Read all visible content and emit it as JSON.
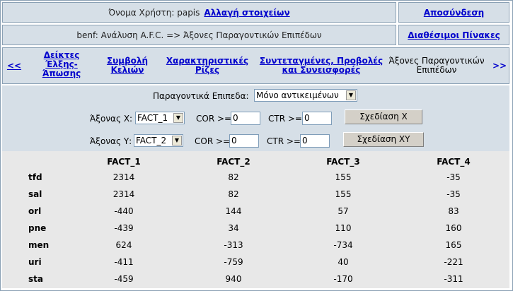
{
  "header": {
    "user_label": "Όνομα Χρήστη: papis",
    "change_details_link": "Αλλαγή στοιχείων",
    "logout_link": "Αποσύνδεση",
    "analysis_title": "benf: Ανάλυση A.F.C. => Άξονες Παραγοντικών Επιπέδων",
    "available_tables_link": "Διαθέσιμοι Πίνακες"
  },
  "nav": {
    "prev": "<<",
    "next": ">>",
    "items": [
      {
        "label": "Δείκτες Έλξης-Άπωσης"
      },
      {
        "label": "Συμβολή Κελιών"
      },
      {
        "label": "Χαρακτηριστικές Ρίζες"
      },
      {
        "label": "Συντεταγμένες, Προβολές και Συνεισφορές"
      },
      {
        "label": "Άξονες Παραγοντικών Επιπέδων"
      }
    ]
  },
  "form": {
    "planes_label": "Παραγοντικά Επιπεδα:",
    "planes_value": "Μόνο αντικειμένων",
    "axis_x_label": "Άξονας Χ:",
    "axis_x_value": "FACT_1",
    "axis_y_label": "Άξονας Υ:",
    "axis_y_value": "FACT_2",
    "cor_label": "COR >=",
    "ctr_label": "CTR >=",
    "cor_x": "0",
    "ctr_x": "0",
    "cor_y": "0",
    "ctr_y": "0",
    "plot_x_button": "Σχεδίαση Χ",
    "plot_xy_button": "Σχεδίαση ΧΥ"
  },
  "table": {
    "columns": [
      "FACT_1",
      "FACT_2",
      "FACT_3",
      "FACT_4"
    ],
    "rows": [
      {
        "label": "tfd",
        "values": [
          "2314",
          "82",
          "155",
          "-35"
        ]
      },
      {
        "label": "sal",
        "values": [
          "2314",
          "82",
          "155",
          "-35"
        ]
      },
      {
        "label": "orl",
        "values": [
          "-440",
          "144",
          "57",
          "83"
        ]
      },
      {
        "label": "pne",
        "values": [
          "-439",
          "34",
          "110",
          "160"
        ]
      },
      {
        "label": "men",
        "values": [
          "624",
          "-313",
          "-734",
          "165"
        ]
      },
      {
        "label": "uri",
        "values": [
          "-411",
          "-759",
          "40",
          "-221"
        ]
      },
      {
        "label": "sta",
        "values": [
          "-459",
          "940",
          "-170",
          "-311"
        ]
      }
    ]
  }
}
